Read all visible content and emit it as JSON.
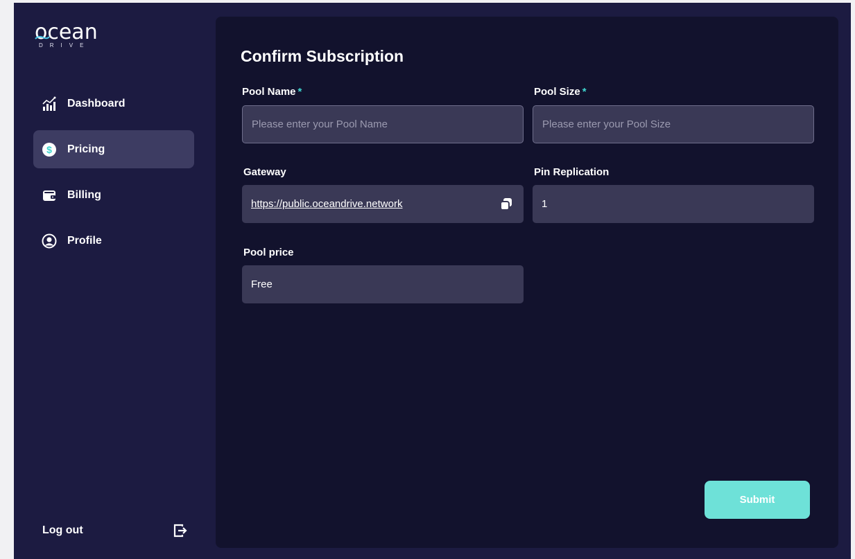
{
  "brand": {
    "name": "ocean",
    "tagline": "DRIVE"
  },
  "sidebar": {
    "items": [
      {
        "label": "Dashboard",
        "icon": "chart-growth-icon",
        "active": false
      },
      {
        "label": "Pricing",
        "icon": "dollar-coin-icon",
        "active": true
      },
      {
        "label": "Billing",
        "icon": "wallet-icon",
        "active": false
      },
      {
        "label": "Profile",
        "icon": "user-circle-icon",
        "active": false
      }
    ],
    "logout_label": "Log out"
  },
  "form": {
    "title": "Confirm Subscription",
    "required_mark": "*",
    "pool_name": {
      "label": "Pool Name",
      "placeholder": "Please enter your Pool Name",
      "value": ""
    },
    "pool_size": {
      "label": "Pool Size",
      "placeholder": "Please enter your Pool Size",
      "value": ""
    },
    "gateway": {
      "label": "Gateway",
      "value": "https://public.oceandrive.network"
    },
    "pin_replication": {
      "label": "Pin Replication",
      "value": "1"
    },
    "pool_price": {
      "label": "Pool price",
      "value": "Free"
    },
    "submit_label": "Submit"
  },
  "colors": {
    "sidebar_bg": "#1c1b41",
    "panel_bg": "#12122d",
    "field_bg": "#3a3956",
    "active_nav_bg": "#3d3c62",
    "accent": "#6ee1d8",
    "required": "#3fd6cf"
  }
}
